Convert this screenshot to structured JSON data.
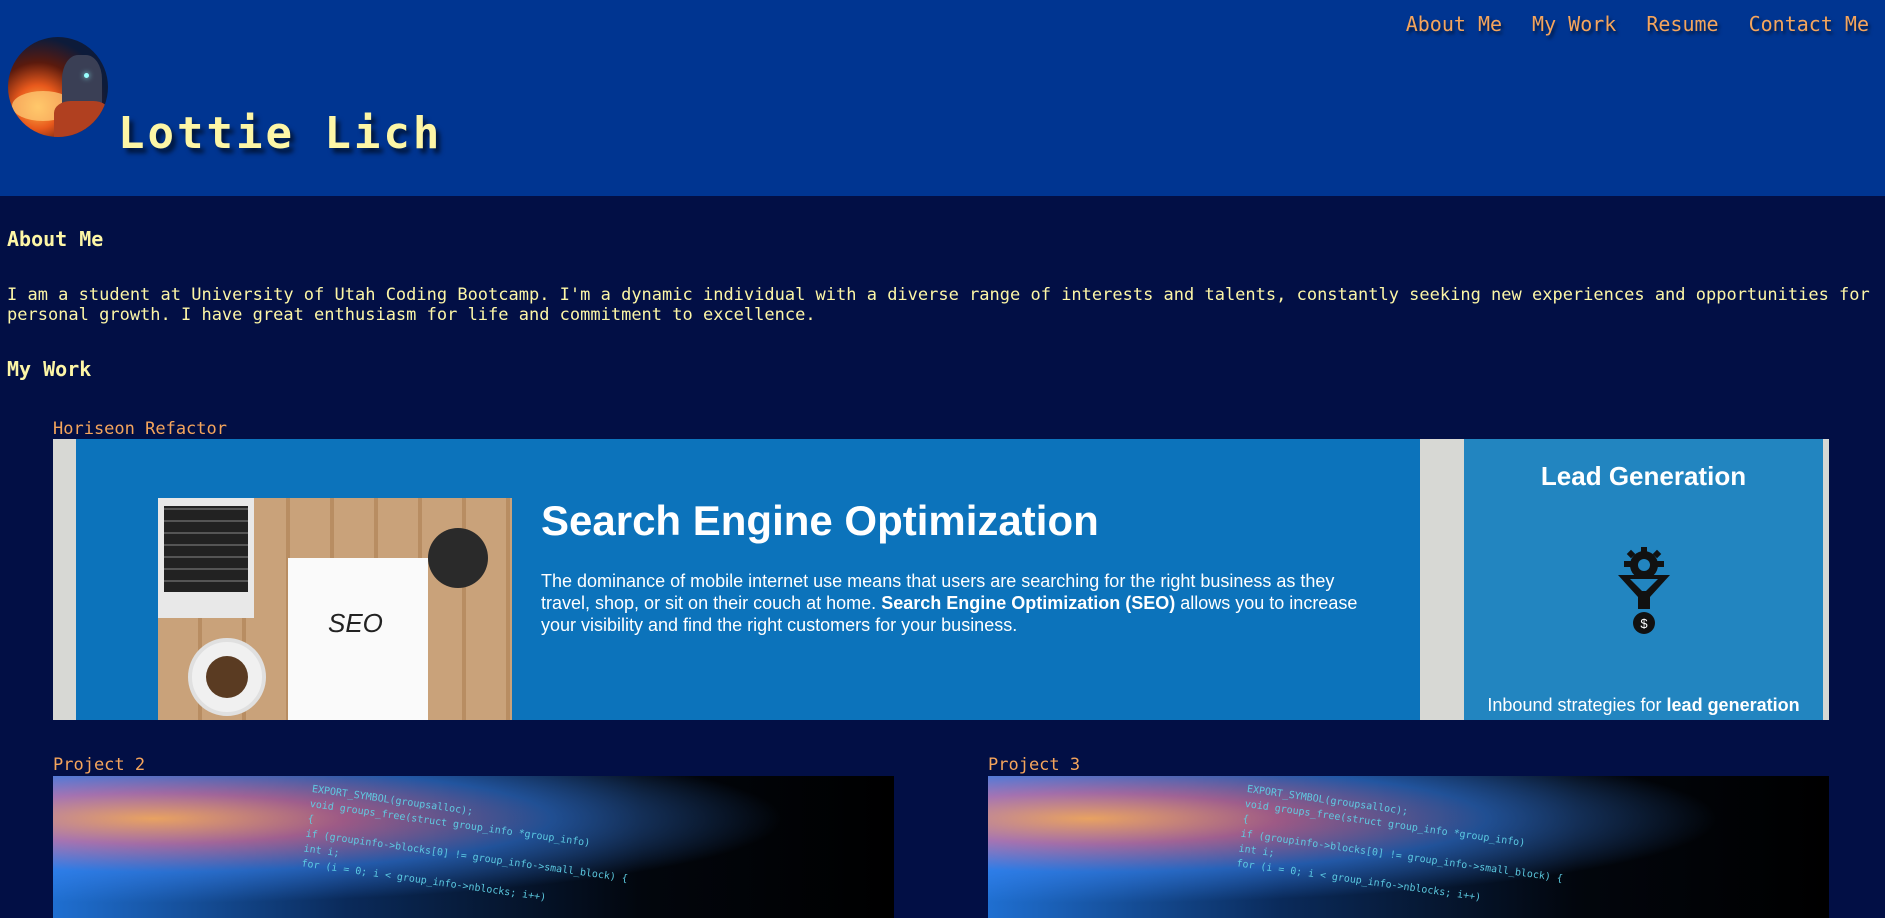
{
  "header": {
    "site_name": "Lottie Lich",
    "nav": [
      {
        "label": "About Me"
      },
      {
        "label": "My Work"
      },
      {
        "label": "Resume"
      },
      {
        "label": "Contact Me"
      }
    ]
  },
  "about": {
    "heading": "About Me",
    "text": "I am a student at University of Utah Coding Bootcamp. I'm a dynamic individual with a diverse range of interests and talents, constantly seeking new experiences and opportunities for personal growth. I have great enthusiasm for life and commitment to excellence."
  },
  "work": {
    "heading": "My Work",
    "featured": {
      "title": "Horiseon Refactor",
      "screenshot": {
        "seo_title": "Search Engine Optimization",
        "seo_body_intro": "The dominance of mobile internet use means that users are searching for the right business as they travel, shop, or sit on their couch at home.",
        "seo_body_bold": "Search Engine Optimization (SEO)",
        "seo_body_rest": "allows you to increase your visibility and find the right customers for your business.",
        "photo_word": "SEO",
        "lead_title": "Lead Generation",
        "lead_sub_intro": "Inbound strategies for",
        "lead_sub_bold": "lead generation"
      }
    },
    "projects": [
      {
        "title": "Project 2"
      },
      {
        "title": "Project 3"
      }
    ],
    "code_lines": [
      "EXPORT_SYMBOL(groupsalloc);",
      "void groups_free(struct group_info *group_info)",
      "{",
      "    if (groupinfo->blocks[0] != group_info->small_block) {",
      "        int i;",
      "        for (i = 0; i < group_info->nblocks; i++)"
    ]
  },
  "colors": {
    "header_bg": "#003591",
    "page_bg": "#020f45",
    "name_color": "#fdf6a6",
    "nav_color": "#f5a55c",
    "seo_blue": "#0c73bb",
    "lead_blue": "#2285c0"
  }
}
